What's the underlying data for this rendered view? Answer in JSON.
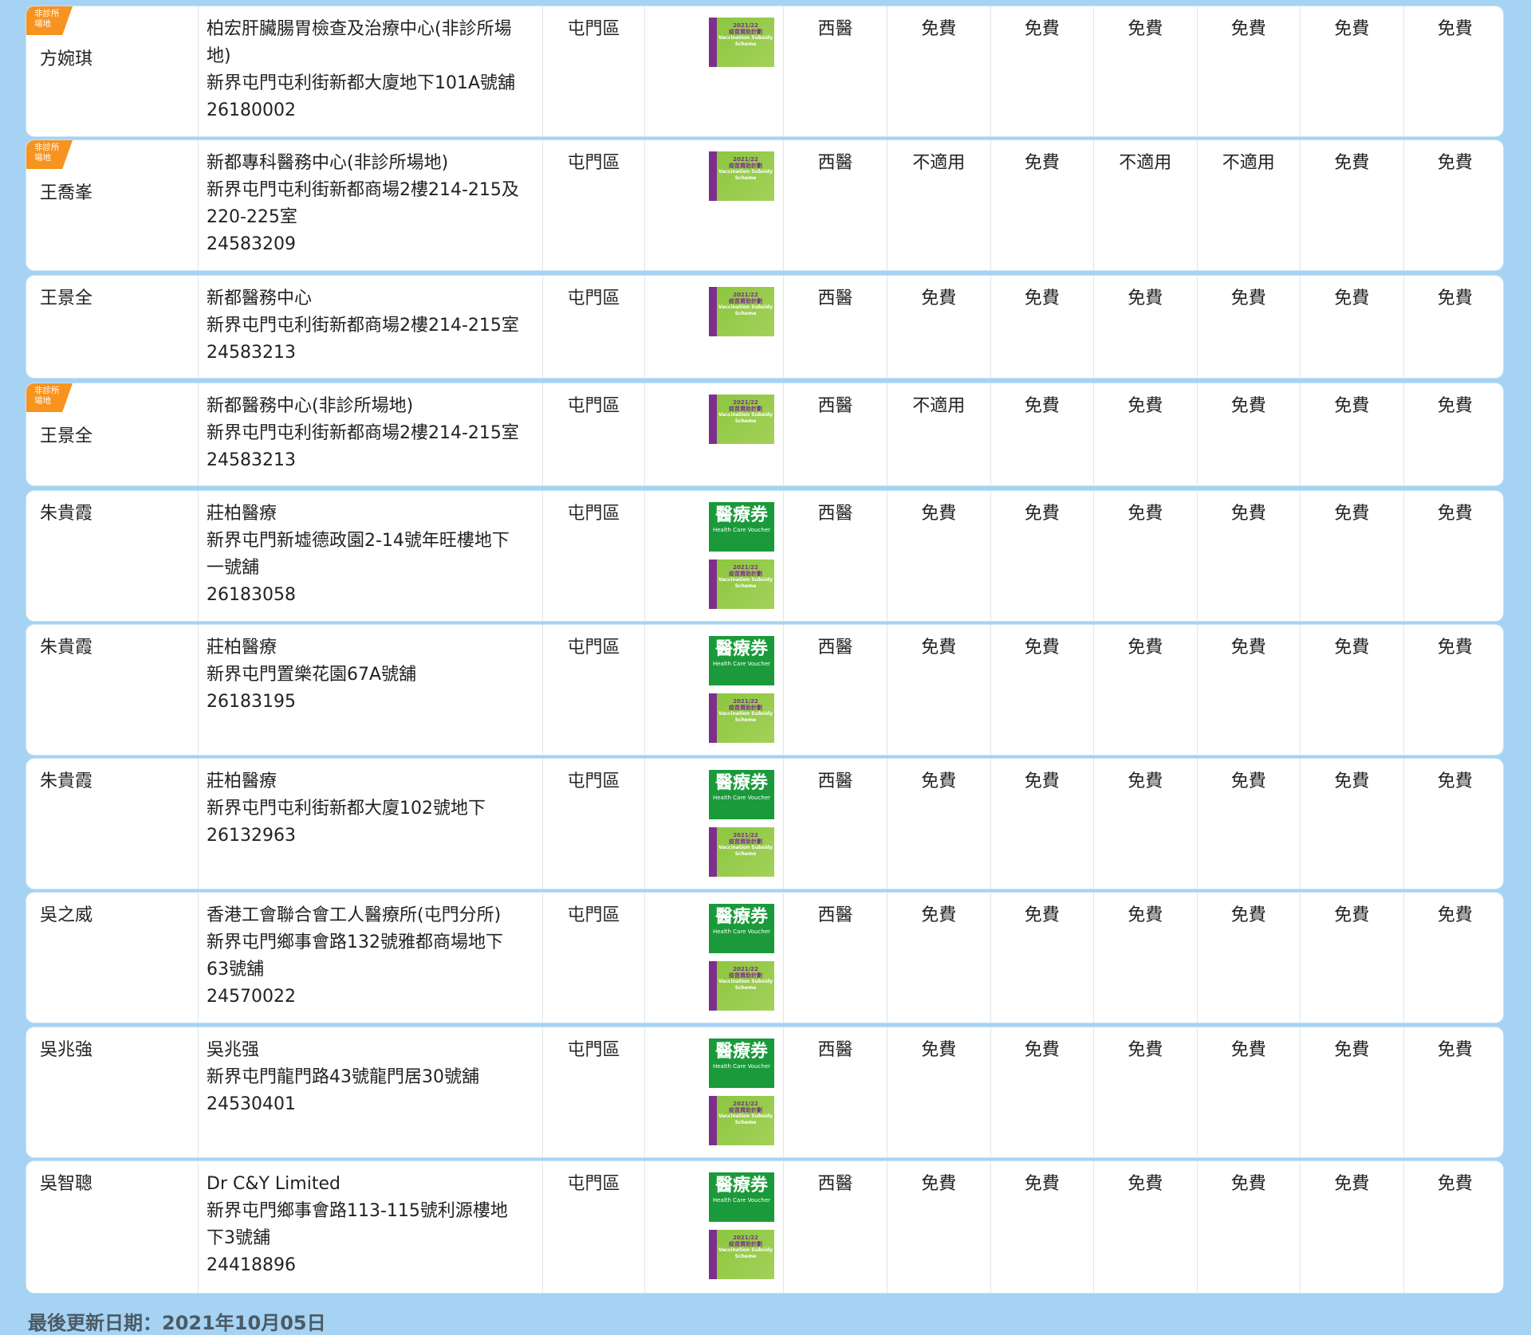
{
  "table": {
    "rows": [
      {
        "non_clinic_tag": "非診所\n場地",
        "doctor": "方婉琪",
        "clinic_lines": [
          "柏宏肝臟腸胃檢查及治療中心(非診所場",
          "地)",
          "新界屯門屯利街新都大廈地下101A號舖",
          "26180002"
        ],
        "district": "屯門區",
        "logos": [
          "vaccination"
        ],
        "type": "西醫",
        "fees": [
          "免費",
          "免費",
          "免費",
          "免費",
          "免費",
          "免費"
        ]
      },
      {
        "non_clinic_tag": "非診所\n場地",
        "doctor": "王喬峯",
        "clinic_lines": [
          "新都專科醫務中心(非診所場地)",
          "新界屯門屯利街新都商場2樓214-215及",
          "220-225室",
          "24583209"
        ],
        "district": "屯門區",
        "logos": [
          "vaccination"
        ],
        "type": "西醫",
        "fees": [
          "不適用",
          "免費",
          "不適用",
          "不適用",
          "免費",
          "免費"
        ]
      },
      {
        "non_clinic_tag": "",
        "doctor": "王景全",
        "clinic_lines": [
          "新都醫務中心",
          "新界屯門屯利街新都商場2樓214-215室",
          "24583213"
        ],
        "district": "屯門區",
        "logos": [
          "vaccination"
        ],
        "type": "西醫",
        "fees": [
          "免費",
          "免費",
          "免費",
          "免費",
          "免費",
          "免費"
        ]
      },
      {
        "non_clinic_tag": "非診所\n場地",
        "doctor": "王景全",
        "clinic_lines": [
          "新都醫務中心(非診所場地)",
          "新界屯門屯利街新都商場2樓214-215室",
          "24583213"
        ],
        "district": "屯門區",
        "logos": [
          "vaccination"
        ],
        "type": "西醫",
        "fees": [
          "不適用",
          "免費",
          "免費",
          "免費",
          "免費",
          "免費"
        ]
      },
      {
        "non_clinic_tag": "",
        "doctor": "朱貴霞",
        "clinic_lines": [
          "莊柏醫療",
          "新界屯門新墟德政園2-14號年旺樓地下",
          "一號舖",
          "26183058"
        ],
        "district": "屯門區",
        "logos": [
          "voucher",
          "vaccination"
        ],
        "type": "西醫",
        "fees": [
          "免費",
          "免費",
          "免費",
          "免費",
          "免費",
          "免費"
        ]
      },
      {
        "non_clinic_tag": "",
        "doctor": "朱貴霞",
        "clinic_lines": [
          "莊柏醫療",
          "新界屯門置樂花園67A號舖",
          "26183195"
        ],
        "district": "屯門區",
        "logos": [
          "voucher",
          "vaccination"
        ],
        "type": "西醫",
        "fees": [
          "免費",
          "免費",
          "免費",
          "免費",
          "免費",
          "免費"
        ]
      },
      {
        "non_clinic_tag": "",
        "doctor": "朱貴霞",
        "clinic_lines": [
          "莊柏醫療",
          "新界屯門屯利街新都大廈102號地下",
          "26132963"
        ],
        "district": "屯門區",
        "logos": [
          "voucher",
          "vaccination"
        ],
        "type": "西醫",
        "fees": [
          "免費",
          "免費",
          "免費",
          "免費",
          "免費",
          "免費"
        ]
      },
      {
        "non_clinic_tag": "",
        "doctor": "吳之威",
        "clinic_lines": [
          "香港工會聯合會工人醫療所(屯門分所)",
          "新界屯門鄉事會路132號雅都商場地下",
          "63號舖",
          "24570022"
        ],
        "district": "屯門區",
        "logos": [
          "voucher",
          "vaccination"
        ],
        "type": "西醫",
        "fees": [
          "免費",
          "免費",
          "免費",
          "免費",
          "免費",
          "免費"
        ]
      },
      {
        "non_clinic_tag": "",
        "doctor": "吳兆強",
        "clinic_lines": [
          "吳兆强",
          "新界屯門龍門路43號龍門居30號舖",
          "24530401"
        ],
        "district": "屯門區",
        "logos": [
          "voucher",
          "vaccination"
        ],
        "type": "西醫",
        "fees": [
          "免費",
          "免費",
          "免費",
          "免費",
          "免費",
          "免費"
        ]
      },
      {
        "non_clinic_tag": "",
        "doctor": "吳智聰",
        "clinic_lines": [
          "Dr C&Y Limited",
          "新界屯門鄉事會路113-115號利源樓地",
          "下3號舖",
          "24418896"
        ],
        "district": "屯門區",
        "logos": [
          "voucher",
          "vaccination"
        ],
        "type": "西醫",
        "fees": [
          "免費",
          "免費",
          "免費",
          "免費",
          "免費",
          "免費"
        ]
      }
    ]
  },
  "logo_text": {
    "vaccination_year": "2021/22",
    "vaccination_zh": "疫苗資助計劃",
    "vaccination_en": "Vaccination Subsidy Scheme",
    "voucher_zh": "醫療券",
    "voucher_en": "Health Care Voucher"
  },
  "footer": {
    "last_updated": "最後更新日期：2021年10月05日"
  }
}
